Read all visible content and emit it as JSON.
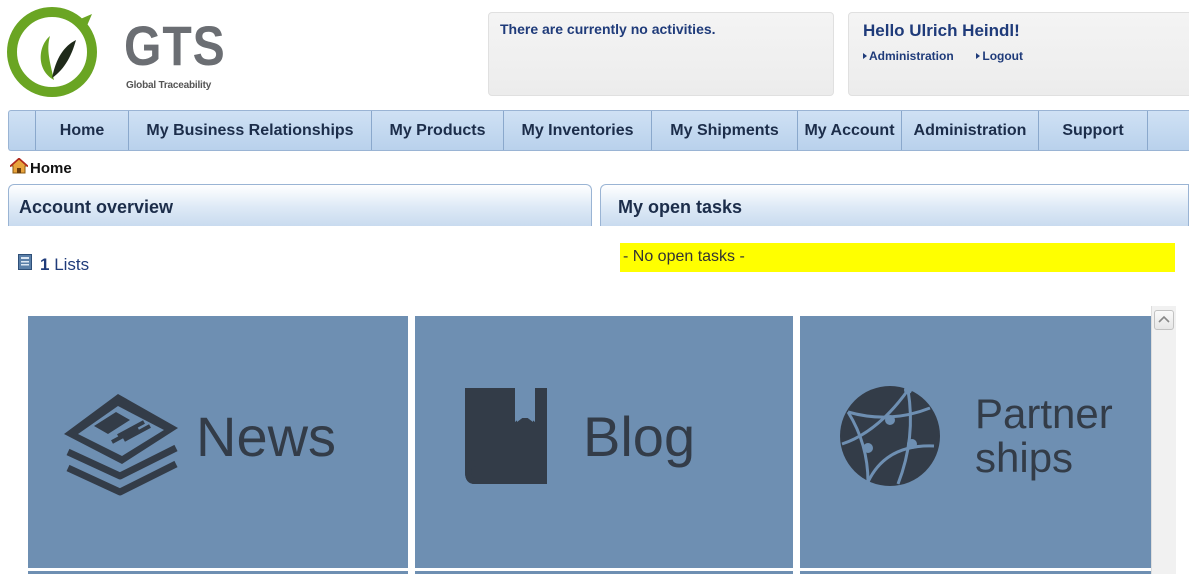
{
  "logo": {
    "name": "GTS",
    "tagline": "Global Traceability"
  },
  "activity": {
    "message": "There are currently no activities."
  },
  "user": {
    "greeting": "Hello Ulrich Heindl!",
    "links": [
      "Administration",
      "Logout"
    ]
  },
  "menu": [
    "Home",
    "My Business Relationships",
    "My Products",
    "My Inventories",
    "My Shipments",
    "My Account",
    "Administration",
    "Support"
  ],
  "breadcrumb": "Home",
  "panels": {
    "left_title": "Account overview",
    "right_title": "My open tasks"
  },
  "lists": {
    "count": "1",
    "label": "Lists"
  },
  "tasks": {
    "empty_message": "- No open tasks -"
  },
  "tiles": [
    {
      "label": "News",
      "icon": "newspaper-icon"
    },
    {
      "label": "Blog",
      "icon": "book-icon"
    },
    {
      "label_line1": "Partner",
      "label_line2": "ships",
      "icon": "globe-network-icon"
    }
  ],
  "colors": {
    "tile_bg": "#6e8fb2",
    "tile_fg": "#333c48",
    "task_highlight": "#ffff00",
    "brand_green": "#6aa523",
    "nav_text": "#1f3b7a"
  }
}
